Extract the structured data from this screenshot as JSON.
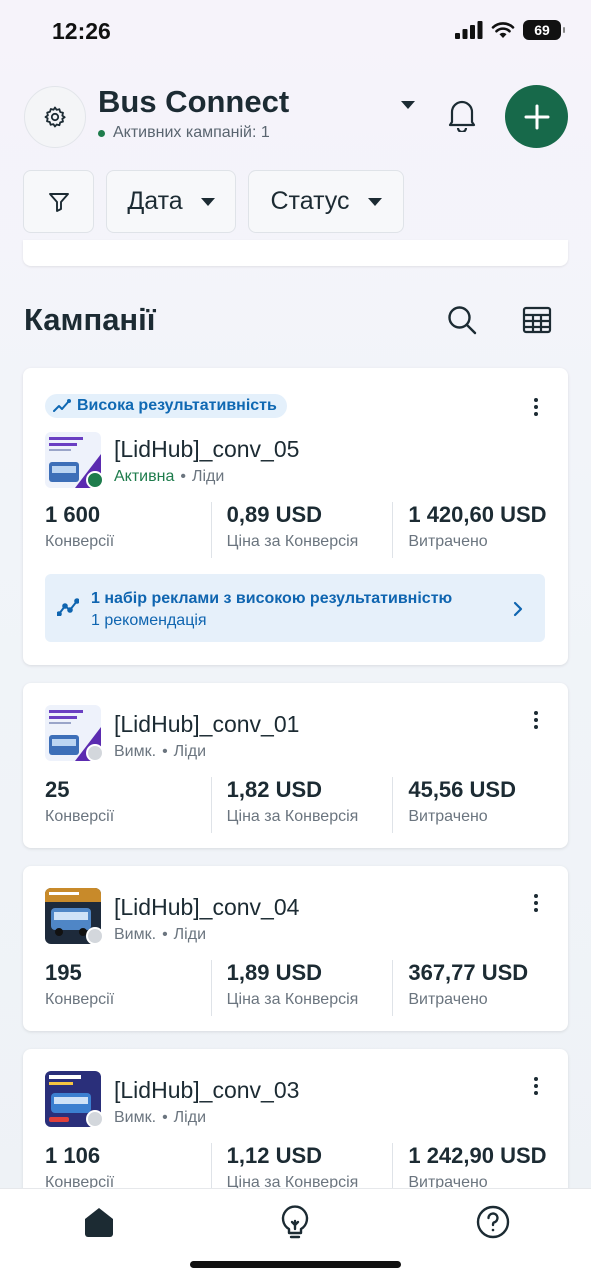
{
  "status_bar": {
    "time": "12:26",
    "battery": "69"
  },
  "header": {
    "account_name": "Bus Connect",
    "active_campaigns": "Активних кампаній: 1"
  },
  "filters": {
    "date": "Дата",
    "status": "Статус"
  },
  "section": {
    "title": "Кампанії"
  },
  "colors": {
    "accent": "#17694a",
    "active_dot": "#1e7c4c",
    "link": "#1069b3",
    "recommendation_bg": "#e6f0fa"
  },
  "campaigns": [
    {
      "badge": "Висока результативність",
      "name": "[LidHub]_conv_05",
      "status": "Активна",
      "objective": "Ліди",
      "metrics": [
        {
          "value": "1 600",
          "label": "Конверсії"
        },
        {
          "value": "0,89 USD",
          "label": "Ціна за Конверсія"
        },
        {
          "value": "1 420,60 USD",
          "label": "Витрачено"
        }
      ],
      "recommendation": {
        "title": "1 набір реклами з високою результативністю",
        "subtitle": "1 рекомендація"
      }
    },
    {
      "name": "[LidHub]_conv_01",
      "status": "Вимк.",
      "objective": "Ліди",
      "metrics": [
        {
          "value": "25",
          "label": "Конверсії"
        },
        {
          "value": "1,82 USD",
          "label": "Ціна за Конверсія"
        },
        {
          "value": "45,56 USD",
          "label": "Витрачено"
        }
      ]
    },
    {
      "name": "[LidHub]_conv_04",
      "status": "Вимк.",
      "objective": "Ліди",
      "metrics": [
        {
          "value": "195",
          "label": "Конверсії"
        },
        {
          "value": "1,89 USD",
          "label": "Ціна за Конверсія"
        },
        {
          "value": "367,77 USD",
          "label": "Витрачено"
        }
      ]
    },
    {
      "name": "[LidHub]_conv_03",
      "status": "Вимк.",
      "objective": "Ліди",
      "metrics": [
        {
          "value": "1 106",
          "label": "Конверсії"
        },
        {
          "value": "1,12 USD",
          "label": "Ціна за Конверсія"
        },
        {
          "value": "1 242,90 USD",
          "label": "Витрачено"
        }
      ]
    }
  ],
  "bottom_nav": [
    {
      "icon": "home-icon"
    },
    {
      "icon": "lightbulb-icon"
    },
    {
      "icon": "help-icon"
    }
  ]
}
